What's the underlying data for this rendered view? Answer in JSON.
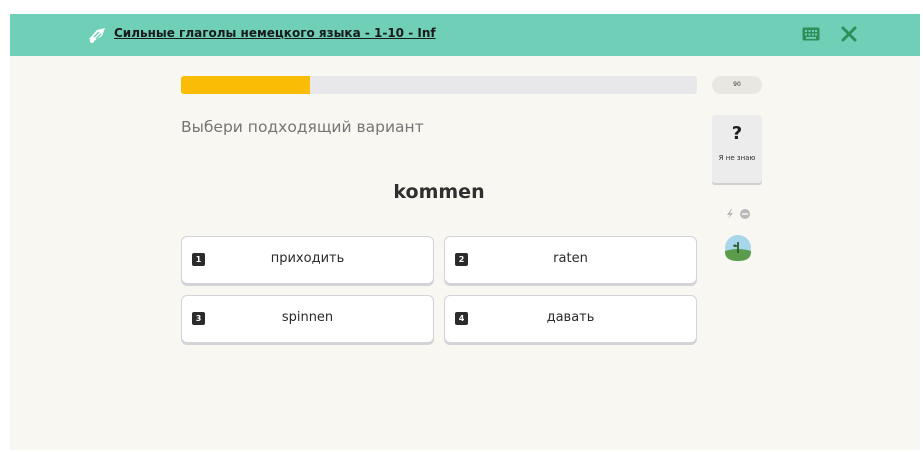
{
  "header": {
    "course_title": "Сильные глаголы немецкого языка - 1-10 - Inf",
    "bg_color": "#6fcfb7"
  },
  "progress": {
    "fraction": 0.25,
    "points": "90",
    "fill_color": "#fbbc05"
  },
  "task": {
    "prompt": "Выбери подходящий вариант",
    "word": "kommen"
  },
  "dont_know": {
    "symbol": "?",
    "label": "Я не знаю"
  },
  "options": [
    {
      "num": "1",
      "text": "приходить"
    },
    {
      "num": "2",
      "text": "raten"
    },
    {
      "num": "3",
      "text": "spinnen"
    },
    {
      "num": "4",
      "text": "давать"
    }
  ],
  "icons": [
    "bee-logo-icon",
    "keyboard-icon",
    "close-icon",
    "lightning-icon",
    "minus-circle-icon",
    "plant-avatar-icon"
  ]
}
